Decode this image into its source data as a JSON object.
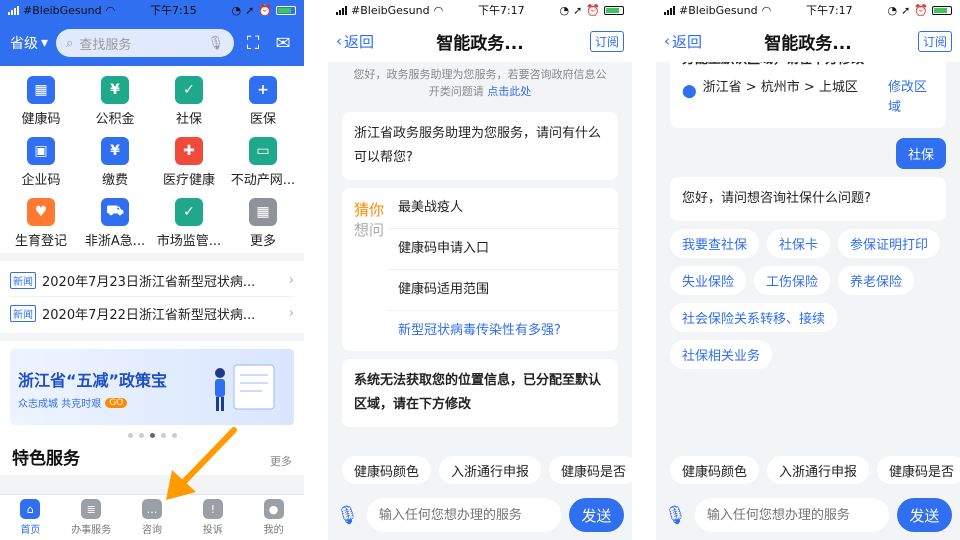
{
  "status_bar": {
    "carrier": "#BleibGesund",
    "time1": "下午7:15",
    "time2": "下午7:17",
    "time3": "下午7:17"
  },
  "home": {
    "region": "省级",
    "search_placeholder": "查找服务",
    "services": [
      {
        "label": "健康码",
        "icon": "qr-code-icon",
        "color": "#2f6ff0"
      },
      {
        "label": "公积金",
        "icon": "house-yuan-icon",
        "color": "#1fa88a"
      },
      {
        "label": "社保",
        "icon": "shield-check-icon",
        "color": "#1fa88a"
      },
      {
        "label": "医保",
        "icon": "shield-plus-icon",
        "color": "#2f6ff0"
      },
      {
        "label": "企业码",
        "icon": "enterprise-code-icon",
        "color": "#2f6ff0"
      },
      {
        "label": "缴费",
        "icon": "yuan-coin-icon",
        "color": "#2f6ff0"
      },
      {
        "label": "医疗健康",
        "icon": "medical-kit-icon",
        "color": "#f04a3a"
      },
      {
        "label": "不动产网...",
        "icon": "monitor-house-icon",
        "color": "#1fa88a"
      },
      {
        "label": "生育登记",
        "icon": "heart-icon",
        "color": "#ff7a30"
      },
      {
        "label": "非浙A急...",
        "icon": "car-icon",
        "color": "#2f6ff0"
      },
      {
        "label": "市场监管...",
        "icon": "chart-check-icon",
        "color": "#1fa88a"
      },
      {
        "label": "更多",
        "icon": "grid-more-icon",
        "color": "#8e9399"
      }
    ],
    "news_tag": "新闻",
    "news": [
      "2020年7月23日浙江省新型冠状病...",
      "2020年7月22日浙江省新型冠状病..."
    ],
    "banner_title": "浙江省“五减”政策宝",
    "banner_sub": "众志成城  共克时艰",
    "banner_go": "GO",
    "special_title": "特色服务",
    "special_more": "更多",
    "tabs": [
      "首页",
      "办事服务",
      "咨询",
      "投诉",
      "我的"
    ]
  },
  "chat": {
    "back_label": "返回",
    "title": "智能政务...",
    "subscribe_label": "订阅",
    "system_msg": "您好，政务服务助理为您服务，若要咨询政府信息公开类问题请",
    "system_link": "点击此处",
    "greeting": "浙江省政务服务助理为您服务，请问有什么可以帮您?",
    "guess_label_1": "猜你",
    "guess_label_2": "想问",
    "guess_items": [
      "最美战疫人",
      "健康码申请入口",
      "健康码适用范围",
      "新型冠状病毒传染性有多强?"
    ],
    "location_msg": "系统无法获取您的位置信息，已分配至默认区域，请在下方修改",
    "location_msg_tail": "分配至默认区域，请在下方修改",
    "location_path": "浙江省 > 杭州市 > 上城区",
    "location_edit": "修改区域",
    "user_msg": "社保",
    "reply": "您好，请问想咨询社保什么问题?",
    "reply_chips": [
      "我要查社保",
      "社保卡",
      "参保证明打印",
      "失业保险",
      "工伤保险",
      "养老保险",
      "社会保险关系转移、接续",
      "社保相关业务"
    ],
    "quick_chips": [
      "健康码颜色",
      "入浙通行申报",
      "健康码是否"
    ],
    "input_placeholder": "输入任何您想办理的服务",
    "send_label": "发送"
  },
  "colors": {
    "accent": "#2f6ff0",
    "orange": "#ff8a00"
  }
}
